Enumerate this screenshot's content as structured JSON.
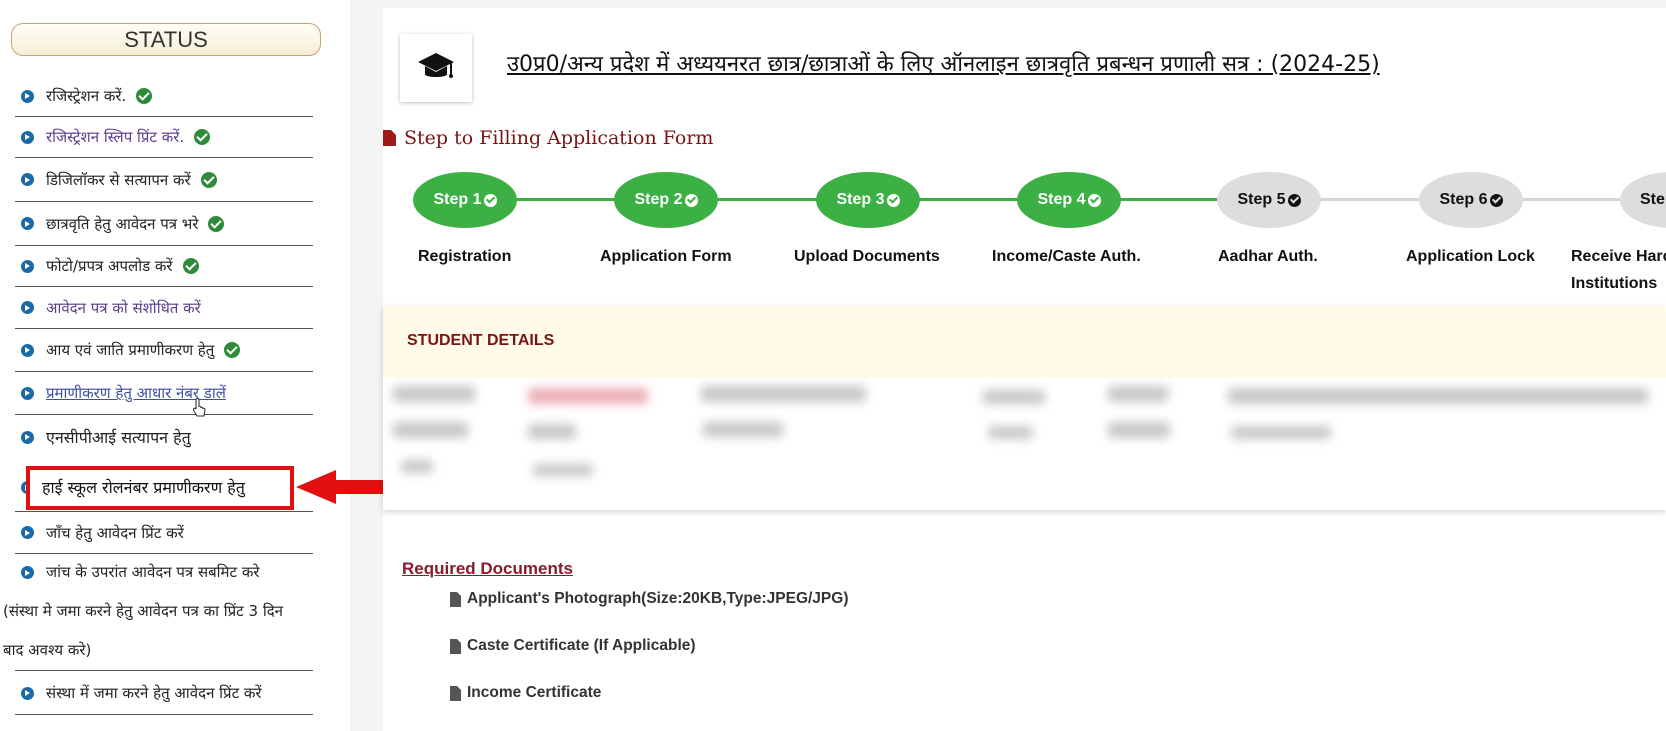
{
  "sidebar": {
    "status_label": "STATUS",
    "items": [
      {
        "label": "रजिस्ट्रेशन करें.",
        "done": true
      },
      {
        "label": "रजिस्ट्रेशन स्लिप प्रिंट करें.",
        "done": true
      },
      {
        "label": "डिजिलॉकर से सत्यापन करें",
        "done": true
      },
      {
        "label": "छात्रवृति हेतु आवेदन पत्र भरे",
        "done": true
      },
      {
        "label": "फोटो/प्रपत्र अपलोड करें",
        "done": true
      },
      {
        "label": "आवेदन पत्र को संशोधित करें",
        "done": false
      },
      {
        "label": "आय एवं जाति प्रमाणीकरण हेतु",
        "done": true
      },
      {
        "label": "प्रमाणीकरण हेतु आधार नंबर डालें",
        "done": false
      },
      {
        "label": "एनसीपीआई सत्यापन हेतु",
        "done": false
      },
      {
        "label": "हाई स्कूल रोलनंबर प्रमाणीकरण हेतु",
        "done": false
      },
      {
        "label": "जाँच हेतु आवेदन प्रिंट करें",
        "done": false
      },
      {
        "label": "जांच के उपरांत आवेदन पत्र सबमिट करे",
        "done": false
      },
      {
        "label": "संस्था में जमा करने हेतु आवेदन प्रिंट करें",
        "done": false
      }
    ],
    "submit_note_line1": "(संस्था मे जमा करने हेतु आवेदन पत्र का प्रिंट 3 दिन",
    "submit_note_line2": "बाद अवश्य करे)"
  },
  "header": {
    "title": "उ0प्र0/अन्य प्रदेश में अध्ययनरत छात्र/छात्राओं के लिए ऑनलाइन छात्रवृति प्रबन्धन प्रणाली सत्र : (2024-25)",
    "logo_icon": "graduation-cap-icon"
  },
  "steps": {
    "heading": "Step to Filling Application Form",
    "items": [
      {
        "pill": "Step 1",
        "label": "Registration",
        "done": true
      },
      {
        "pill": "Step 2",
        "label": "Application Form",
        "done": true
      },
      {
        "pill": "Step 3",
        "label": "Upload Documents",
        "done": true
      },
      {
        "pill": "Step 4",
        "label": "Income/Caste Auth.",
        "done": true
      },
      {
        "pill": "Step 5",
        "label": "Aadhar Auth.",
        "done": false
      },
      {
        "pill": "Step 6",
        "label": "Application Lock",
        "done": false
      },
      {
        "pill": "Step",
        "label": "Receive Harc",
        "label2": "Institutions",
        "done": false
      }
    ]
  },
  "student": {
    "title": "STUDENT DETAILS"
  },
  "required_documents": {
    "title": "Required Documents",
    "items": [
      "Applicant's Photograph(Size:20KB,Type:JPEG/JPG)",
      "Caste Certificate (If Applicable)",
      "Income Certificate"
    ]
  },
  "colors": {
    "done_green": "#3cb044",
    "pending_gray": "#dddddd",
    "highlight_red": "#e01010",
    "accent_maroon": "#7a1414"
  }
}
